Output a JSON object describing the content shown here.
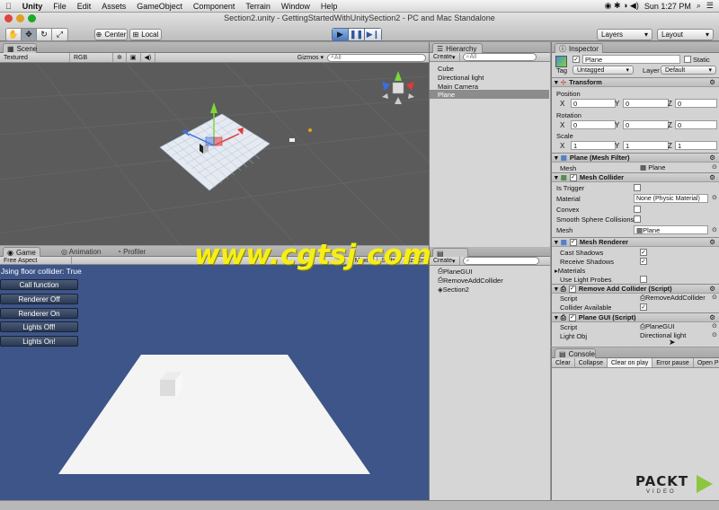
{
  "menubar": {
    "apple": "",
    "items": [
      "Unity",
      "File",
      "Edit",
      "Assets",
      "GameObject",
      "Component",
      "Terrain",
      "Window",
      "Help"
    ],
    "clock": "Sun 1:27 PM"
  },
  "window_title": "Section2.unity - GettingStartedWithUnitySection2 - PC and Mac Standalone",
  "toolbar": {
    "pivot": "Center",
    "space": "Local",
    "layers": "Layers",
    "layout": "Layout"
  },
  "scene": {
    "tab": "Scene",
    "render_mode": "Textured",
    "color_mode": "RGB",
    "gizmos": "Gizmos",
    "search": "All"
  },
  "game": {
    "tabs": [
      "Game",
      "Animation",
      "Profiler"
    ],
    "aspect": "Free Aspect",
    "maximize": "Maxim",
    "stats": "Stats",
    "gizmos": "Gizmos",
    "label": "Jsing floor collider: True",
    "buttons": [
      "Call function",
      "Renderer Off",
      "Renderer On",
      "Lights Off!",
      "Lights On!"
    ]
  },
  "hierarchy": {
    "tab": "Hierarchy",
    "create": "Create",
    "search": "All",
    "items": [
      "Cube",
      "Directional light",
      "Main Camera",
      "Plane"
    ],
    "selected": "Plane"
  },
  "project": {
    "create": "Create",
    "items": [
      "PlaneGUI",
      "RemoveAddCollider",
      "Section2"
    ]
  },
  "watermark": "www.cgtsj.com",
  "inspector": {
    "tab": "Inspector",
    "object_name": "Plane",
    "static_label": "Static",
    "tag_label": "Tag",
    "tag_value": "Untagged",
    "layer_label": "Layer",
    "layer_value": "Default",
    "transform": {
      "title": "Transform",
      "position_label": "Position",
      "rotation_label": "Rotation",
      "scale_label": "Scale",
      "position": [
        "0",
        "0",
        "0"
      ],
      "rotation": [
        "0",
        "0",
        "0"
      ],
      "scale": [
        "1",
        "1",
        "1"
      ],
      "axis": [
        "X",
        "Y",
        "Z"
      ]
    },
    "mesh_filter": {
      "title": "Plane (Mesh Filter)",
      "mesh_label": "Mesh",
      "mesh_value": "Plane"
    },
    "mesh_collider": {
      "title": "Mesh Collider",
      "is_trigger": "Is Trigger",
      "material_label": "Material",
      "material_value": "None (Physic Material)",
      "convex": "Convex",
      "smooth": "Smooth Sphere Collisions",
      "mesh_label": "Mesh",
      "mesh_value": "Plane"
    },
    "mesh_renderer": {
      "title": "Mesh Renderer",
      "cast": "Cast Shadows",
      "receive": "Receive Shadows",
      "materials": "Materials",
      "light_probes": "Use Light Probes"
    },
    "remove_add": {
      "title": "Remove Add Collider (Script)",
      "script_label": "Script",
      "script_value": "RemoveAddCollider",
      "collider_label": "Collider Available"
    },
    "plane_gui": {
      "title": "Plane GUI (Script)",
      "script_label": "Script",
      "script_value": "PlaneGUI",
      "light_label": "Light Obj",
      "light_value": "Directional light"
    }
  },
  "console": {
    "tab": "Console",
    "buttons": [
      "Clear",
      "Collapse",
      "Clear on play",
      "Error pause",
      "Open Player Lo"
    ]
  },
  "logo": {
    "text": "PACKT",
    "sub": "VIDEO"
  }
}
